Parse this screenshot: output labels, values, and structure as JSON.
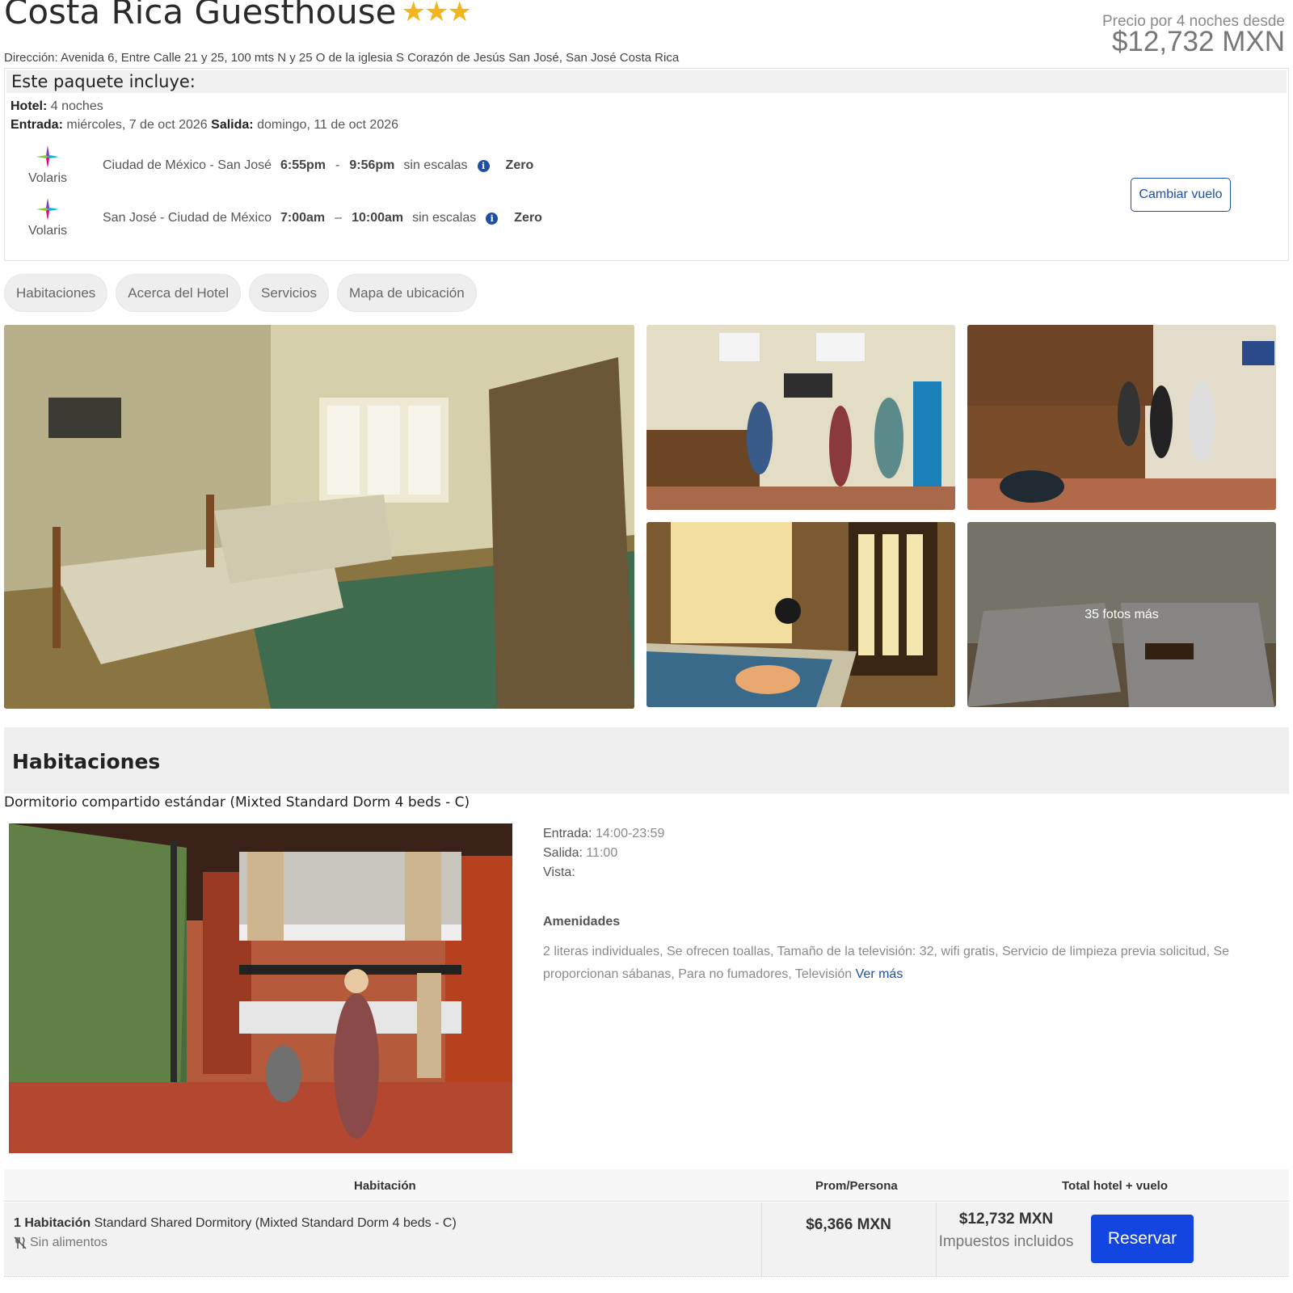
{
  "header": {
    "title": "Costa Rica Guesthouse",
    "stars": "★★★",
    "address": "Dirección: Avenida 6, Entre Calle 21 y 25, 100 mts N y 25 O de la iglesia S Corazón de Jesús San José, San José Costa Rica",
    "price_label": "Precio por 4 noches desde",
    "price_value": "$12,732 MXN"
  },
  "package": {
    "title": "Este paquete incluye:",
    "hotel_label": "Hotel:",
    "hotel_value": "4 noches",
    "checkin_label": "Entrada:",
    "checkin_value": "miércoles, 7 de oct 2026",
    "checkout_label": "Salida:",
    "checkout_value": "domingo, 11 de oct 2026",
    "flights": [
      {
        "airline": "Volaris",
        "route": "Ciudad de México - San José",
        "depart": "6:55pm",
        "sep": "-",
        "arrive": "9:56pm",
        "stops": "sin escalas",
        "fare": "Zero"
      },
      {
        "airline": "Volaris",
        "route": "San José - Ciudad de México",
        "depart": "7:00am",
        "sep": "–",
        "arrive": "10:00am",
        "stops": "sin escalas",
        "fare": "Zero"
      }
    ],
    "info_icon": "i",
    "change_flight_label": "Cambiar vuelo"
  },
  "tabs": [
    "Habitaciones",
    "Acerca del Hotel",
    "Servicios",
    "Mapa de ubicación"
  ],
  "gallery": {
    "more_photos_label": "35 fotos más"
  },
  "rooms": {
    "heading": "Habitaciones",
    "room_name": "Dormitorio compartido estándar (Mixted Standard Dorm 4 beds - C)",
    "checkin_label": "Entrada:",
    "checkin_value": "14:00-23:59",
    "checkout_label": "Salida:",
    "checkout_value": "11:00",
    "view_label": "Vista:",
    "amenities_title": "Amenidades",
    "amenities_text": "2 literas individuales, Se ofrecen toallas, Tamaño de la televisión: 32, wifi gratis, Servicio de limpieza previa solicitud, Se proporcionan sábanas, Para no fumadores, Televisión",
    "see_more": "Ver más"
  },
  "rate_table": {
    "headers": {
      "room": "Habitación",
      "avg": "Prom/Persona",
      "total": "Total hotel + vuelo"
    },
    "row": {
      "room_count": "1 Habitación",
      "room_desc": "Standard Shared Dormitory (Mixted Standard Dorm 4 beds - C)",
      "meal": "Sin alimentos",
      "avg_price": "$6,366 MXN",
      "total_price": "$12,732 MXN",
      "tax_note": "Impuestos incluidos",
      "reserve_label": "Reservar"
    }
  },
  "colors": {
    "accent_blue": "#1d4fa8",
    "reserve_blue": "#1346e0",
    "star_gold": "#f2b51d"
  },
  "icons": [
    "volaris-logo-icon",
    "info-icon",
    "no-food-icon"
  ]
}
